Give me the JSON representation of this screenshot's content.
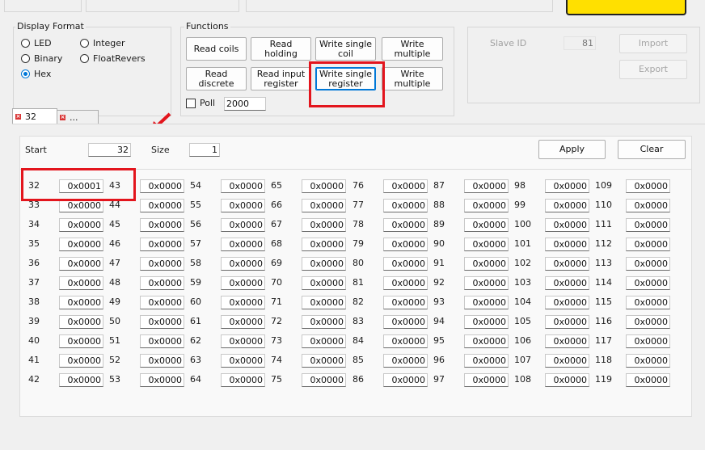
{
  "display_format": {
    "title": "Display Format",
    "options": [
      "LED",
      "Integer",
      "Binary",
      "FloatRevers",
      "Hex"
    ],
    "selected": "Hex"
  },
  "functions": {
    "title": "Functions",
    "buttons": [
      "Read coils",
      "Read\nholding",
      "Write single\ncoil",
      "Write\nmultiple",
      "Read\ndiscrete",
      "Read input\nregister",
      "Write single\nregister",
      "Write\nmultiple"
    ],
    "poll_label": "Poll",
    "poll_value": "2000"
  },
  "slave": {
    "id_label": "Slave ID",
    "id_value": "81",
    "import_label": "Import",
    "export_label": "Export"
  },
  "tabs": [
    "32",
    "..."
  ],
  "register_panel": {
    "start_label": "Start",
    "start_value": "32",
    "size_label": "Size",
    "size_value": "1",
    "apply_label": "Apply",
    "clear_label": "Clear"
  },
  "registers": {
    "columns": [
      {
        "addresses": [
          "32",
          "33",
          "34",
          "35",
          "36",
          "37",
          "38",
          "39",
          "40",
          "41",
          "42"
        ],
        "values": [
          "0x0001",
          "0x0000",
          "0x0000",
          "0x0000",
          "0x0000",
          "0x0000",
          "0x0000",
          "0x0000",
          "0x0000",
          "0x0000",
          "0x0000"
        ]
      },
      {
        "addresses": [
          "43",
          "44",
          "45",
          "46",
          "47",
          "48",
          "49",
          "50",
          "51",
          "52",
          "53"
        ],
        "values": [
          "0x0000",
          "0x0000",
          "0x0000",
          "0x0000",
          "0x0000",
          "0x0000",
          "0x0000",
          "0x0000",
          "0x0000",
          "0x0000",
          "0x0000"
        ]
      },
      {
        "addresses": [
          "54",
          "55",
          "56",
          "57",
          "58",
          "59",
          "60",
          "61",
          "62",
          "63",
          "64"
        ],
        "values": [
          "0x0000",
          "0x0000",
          "0x0000",
          "0x0000",
          "0x0000",
          "0x0000",
          "0x0000",
          "0x0000",
          "0x0000",
          "0x0000",
          "0x0000"
        ]
      },
      {
        "addresses": [
          "65",
          "66",
          "67",
          "68",
          "69",
          "70",
          "71",
          "72",
          "73",
          "74",
          "75"
        ],
        "values": [
          "0x0000",
          "0x0000",
          "0x0000",
          "0x0000",
          "0x0000",
          "0x0000",
          "0x0000",
          "0x0000",
          "0x0000",
          "0x0000",
          "0x0000"
        ]
      },
      {
        "addresses": [
          "76",
          "77",
          "78",
          "79",
          "80",
          "81",
          "82",
          "83",
          "84",
          "85",
          "86"
        ],
        "values": [
          "0x0000",
          "0x0000",
          "0x0000",
          "0x0000",
          "0x0000",
          "0x0000",
          "0x0000",
          "0x0000",
          "0x0000",
          "0x0000",
          "0x0000"
        ]
      },
      {
        "addresses": [
          "87",
          "88",
          "89",
          "90",
          "91",
          "92",
          "93",
          "94",
          "95",
          "96",
          "97"
        ],
        "values": [
          "0x0000",
          "0x0000",
          "0x0000",
          "0x0000",
          "0x0000",
          "0x0000",
          "0x0000",
          "0x0000",
          "0x0000",
          "0x0000",
          "0x0000"
        ]
      },
      {
        "addresses": [
          "98",
          "99",
          "100",
          "101",
          "102",
          "103",
          "104",
          "105",
          "106",
          "107",
          "108"
        ],
        "values": [
          "0x0000",
          "0x0000",
          "0x0000",
          "0x0000",
          "0x0000",
          "0x0000",
          "0x0000",
          "0x0000",
          "0x0000",
          "0x0000",
          "0x0000"
        ]
      },
      {
        "addresses": [
          "109",
          "110",
          "111",
          "112",
          "113",
          "114",
          "115",
          "116",
          "117",
          "118",
          "119"
        ],
        "values": [
          "0x0000",
          "0x0000",
          "0x0000",
          "0x0000",
          "0x0000",
          "0x0000",
          "0x0000",
          "0x0000",
          "0x0000",
          "0x0000",
          "0x0000"
        ]
      }
    ]
  },
  "colors": {
    "highlight": "#e3151d",
    "accent": "#0078d7",
    "logo_yellow": "#ffe000"
  }
}
